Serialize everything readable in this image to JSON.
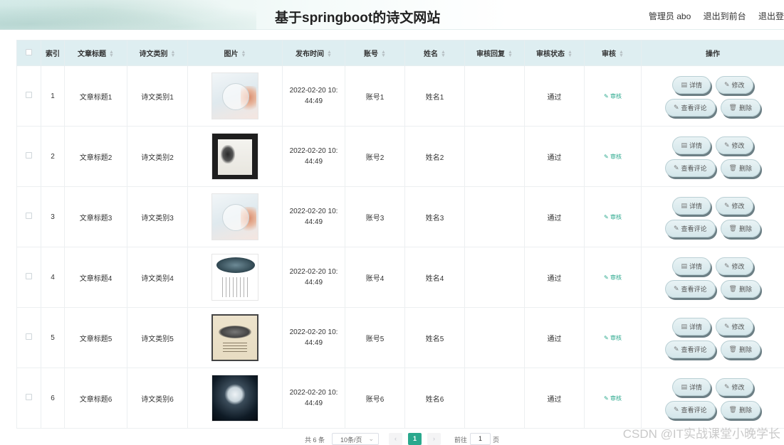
{
  "header": {
    "title": "基于springboot的诗文网站",
    "admin_label": "管理员 abo",
    "back_front": "退出到前台",
    "logout": "退出登"
  },
  "table": {
    "columns": [
      "索引",
      "文章标题",
      "诗文类别",
      "图片",
      "发布时间",
      "账号",
      "姓名",
      "审核回复",
      "审核状态",
      "审核",
      "操作"
    ],
    "rows": [
      {
        "index": "1",
        "title": "文章标题1",
        "category": "诗文类别1",
        "date1": "2022-02-20 10:",
        "date2": "44:49",
        "account": "账号1",
        "name": "姓名1",
        "reply": "",
        "status": "通过",
        "audit": "审核"
      },
      {
        "index": "2",
        "title": "文章标题2",
        "category": "诗文类别2",
        "date1": "2022-02-20 10:",
        "date2": "44:49",
        "account": "账号2",
        "name": "姓名2",
        "reply": "",
        "status": "通过",
        "audit": "审核"
      },
      {
        "index": "3",
        "title": "文章标题3",
        "category": "诗文类别3",
        "date1": "2022-02-20 10:",
        "date2": "44:49",
        "account": "账号3",
        "name": "姓名3",
        "reply": "",
        "status": "通过",
        "audit": "审核"
      },
      {
        "index": "4",
        "title": "文章标题4",
        "category": "诗文类别4",
        "date1": "2022-02-20 10:",
        "date2": "44:49",
        "account": "账号4",
        "name": "姓名4",
        "reply": "",
        "status": "通过",
        "audit": "审核"
      },
      {
        "index": "5",
        "title": "文章标题5",
        "category": "诗文类别5",
        "date1": "2022-02-20 10:",
        "date2": "44:49",
        "account": "账号5",
        "name": "姓名5",
        "reply": "",
        "status": "通过",
        "audit": "审核"
      },
      {
        "index": "6",
        "title": "文章标题6",
        "category": "诗文类别6",
        "date1": "2022-02-20 10:",
        "date2": "44:49",
        "account": "账号6",
        "name": "姓名6",
        "reply": "",
        "status": "通过",
        "audit": "审核"
      }
    ]
  },
  "actions": {
    "detail": "详情",
    "edit": "修改",
    "comments": "查看评论",
    "delete": "删除"
  },
  "pager": {
    "total": "共 6 条",
    "page_size": "10条/页",
    "current": "1",
    "goto": "前往",
    "jump_value": "1",
    "page_unit": "页"
  },
  "watermark": "CSDN @IT实战课堂小晚学长",
  "colors": {
    "accent": "#2aa88d",
    "header_bg": "#deeef1"
  }
}
